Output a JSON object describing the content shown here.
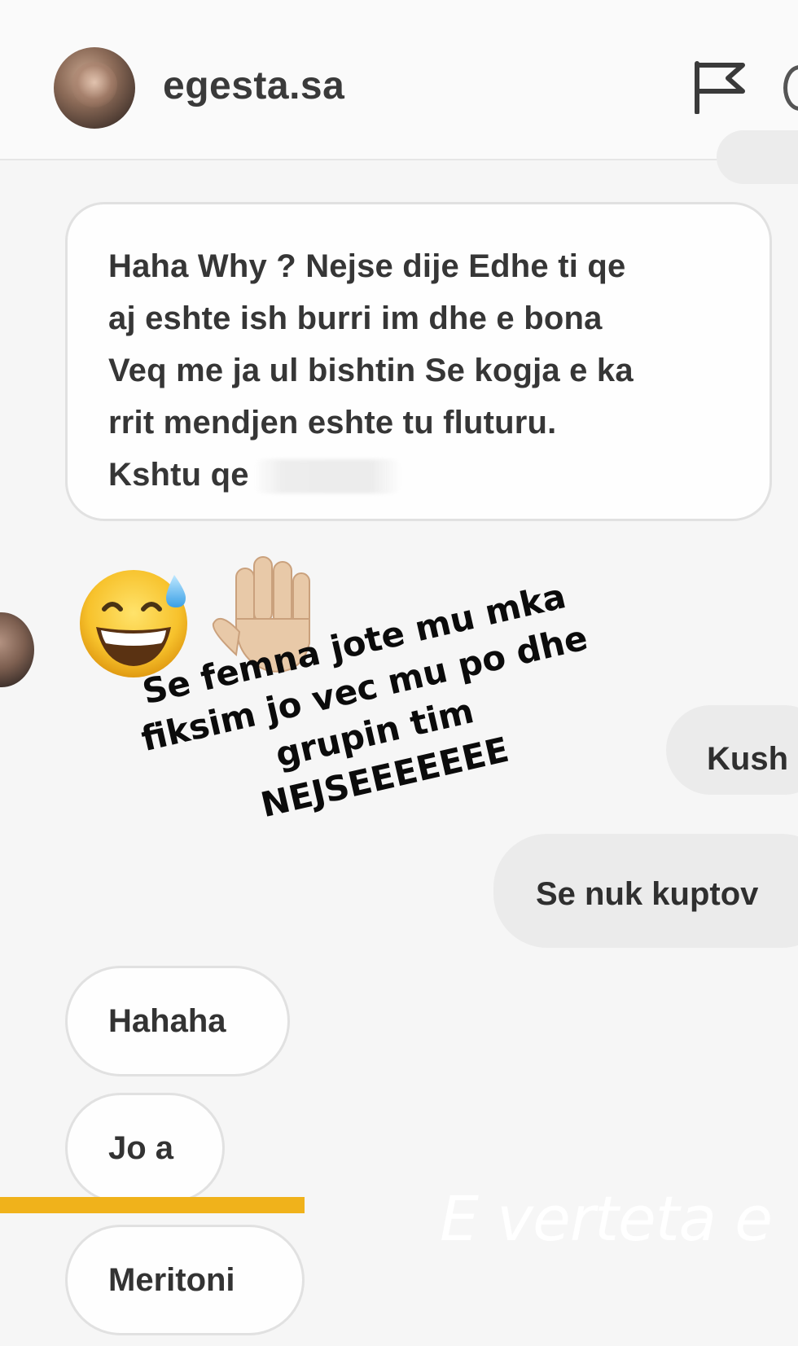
{
  "header": {
    "username": "egesta.sa",
    "report_icon": "flag-icon",
    "info_icon": "info-icon"
  },
  "messages": {
    "main": {
      "lines": [
        "Haha Why ? Nejse dije Edhe ti qe",
        "aj eshte ish burri im  dhe e bona",
        "Veq me ja ul bishtin Se kogja e ka",
        "rrit mendjen eshte tu fluturu.",
        "Kshtu qe"
      ]
    },
    "emojis": [
      "grinning-face-with-sweat-icon",
      "raised-hand-icon"
    ],
    "sent_1": "Kush",
    "sent_2": "Se nuk kuptov",
    "received_2": "Hahaha",
    "received_3": "Jo a",
    "received_4": "Meritoni"
  },
  "overlay_text": {
    "lines": [
      "Se femna jote mu mka",
      "fiksim jo vec mu po dhe",
      "grupin tim",
      "NEJSEEEEEEE"
    ]
  },
  "watermark": "E verteta e",
  "colors": {
    "accent_bar": "#f0b21b",
    "bubble_sent": "#ebebeb",
    "bubble_received": "#fefefe"
  }
}
